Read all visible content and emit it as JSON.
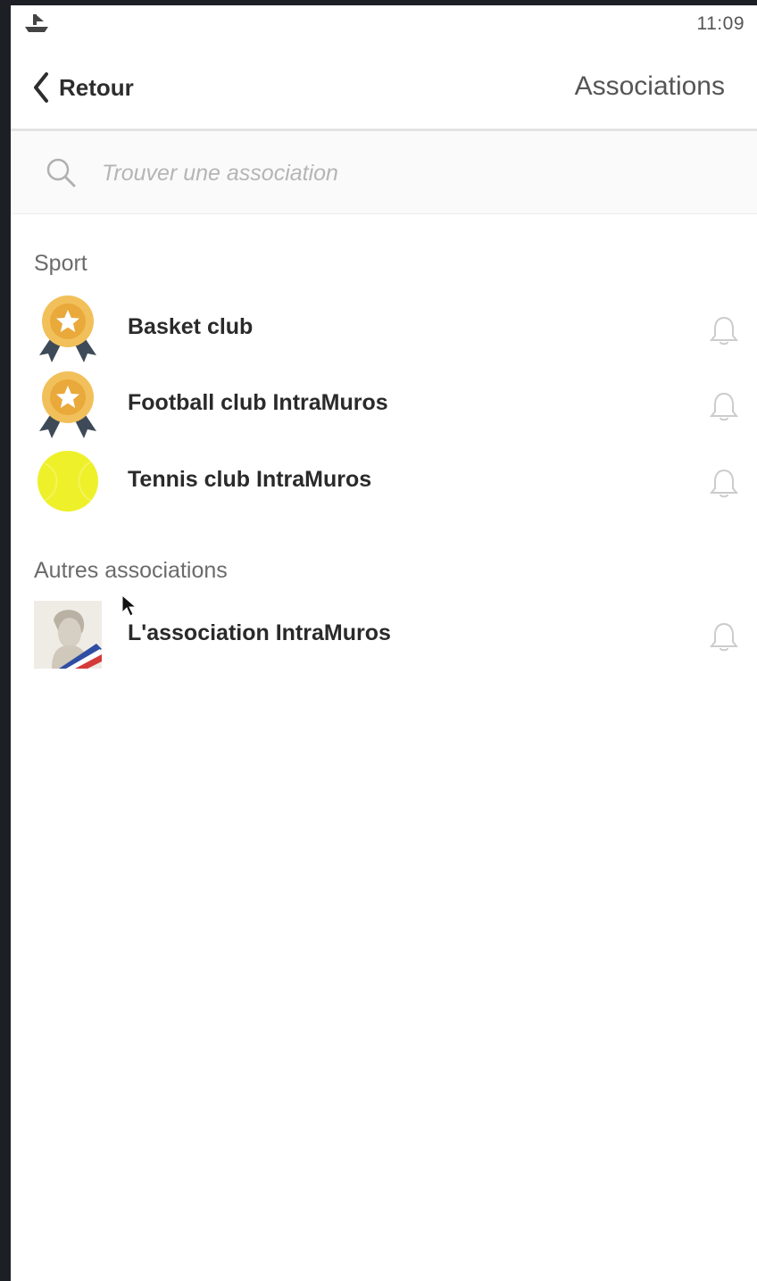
{
  "status_bar": {
    "time": "11:09",
    "notification_icon": "boat-icon"
  },
  "nav": {
    "back_label": "Retour",
    "title": "Associations"
  },
  "search": {
    "placeholder": "Trouver une association",
    "value": ""
  },
  "sections": [
    {
      "title": "Sport",
      "items": [
        {
          "label": "Basket club",
          "icon": "medal-icon"
        },
        {
          "label": "Football club IntraMuros",
          "icon": "medal-icon"
        },
        {
          "label": "Tennis club IntraMuros",
          "icon": "tennis-ball-icon"
        }
      ]
    },
    {
      "title": "Autres associations",
      "items": [
        {
          "label": "L'association IntraMuros",
          "icon": "marianne-avatar"
        }
      ]
    }
  ],
  "colors": {
    "medal": "#f2c05a",
    "ribbon": "#3e4a57",
    "tennis_ball": "#eef02a",
    "bell": "#cccccc"
  }
}
